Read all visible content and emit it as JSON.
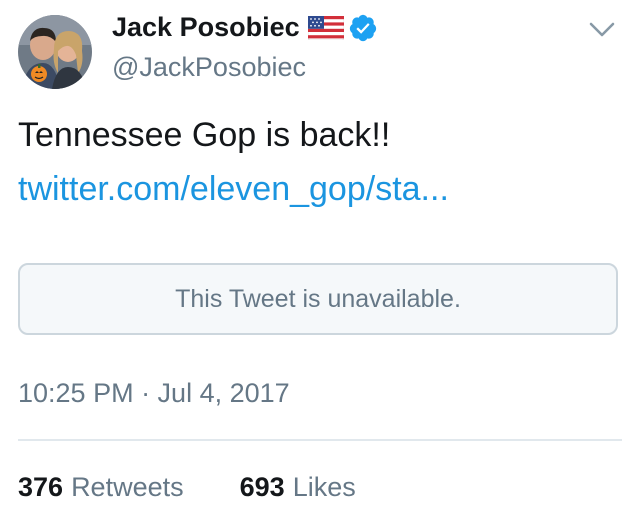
{
  "author": {
    "display_name": "Jack Posobiec",
    "handle": "@JackPosobiec",
    "flag_icon": "us-flag-icon",
    "verified_icon": "verified-badge-icon",
    "menu_icon": "chevron-down-icon"
  },
  "tweet": {
    "text": "Tennessee Gop is back!!",
    "link": "twitter.com/eleven_gop/sta...",
    "quoted_unavailable": "This Tweet is unavailable.",
    "timestamp": "10:25 PM · Jul 4, 2017"
  },
  "stats": {
    "retweets_count": "376",
    "retweets_label": "Retweets",
    "likes_count": "693",
    "likes_label": "Likes"
  },
  "colors": {
    "link": "#1b95e0",
    "muted": "#657786",
    "text": "#14171a",
    "verified": "#1da1f2",
    "border": "#ccd6dd"
  }
}
